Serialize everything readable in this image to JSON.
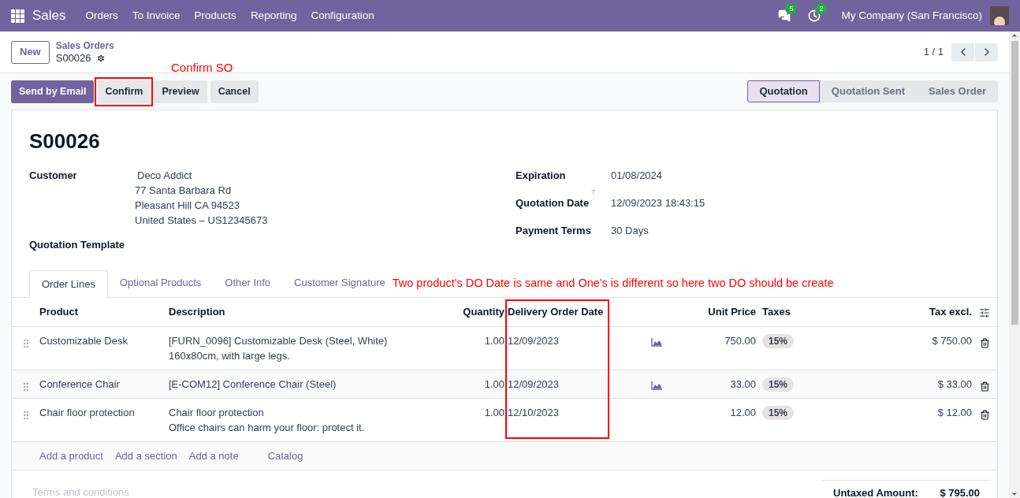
{
  "navbar": {
    "app": "Sales",
    "menu": [
      "Orders",
      "To Invoice",
      "Products",
      "Reporting",
      "Configuration"
    ],
    "messages_count": "5",
    "activities_count": "2",
    "company": "My Company (San Francisco)"
  },
  "control_panel": {
    "new_button": "New",
    "breadcrumb_parent": "Sales Orders",
    "record": "S00026",
    "pager": "1 / 1"
  },
  "actions": [
    {
      "label": "Send by Email",
      "kind": "primary",
      "highlighted": false
    },
    {
      "label": "Confirm",
      "kind": "secondary",
      "highlighted": true
    },
    {
      "label": "Preview",
      "kind": "secondary",
      "highlighted": false
    },
    {
      "label": "Cancel",
      "kind": "secondary",
      "highlighted": false
    }
  ],
  "confirm_note": "Confirm SO",
  "status_steps": [
    {
      "label": "Quotation",
      "selected": true
    },
    {
      "label": "Quotation Sent",
      "selected": false
    },
    {
      "label": "Sales Order",
      "selected": false
    }
  ],
  "form": {
    "title": "S00026",
    "customer": {
      "label": "Customer",
      "name": "Deco Addict",
      "address": [
        "77 Santa Barbara Rd",
        "Pleasant Hill CA 94523",
        "United States – US12345673"
      ]
    },
    "quotation_template": {
      "label": "Quotation Template"
    },
    "right_fields": [
      {
        "label": "Expiration",
        "value": "01/08/2024",
        "help": false
      },
      {
        "label": "Quotation Date",
        "value": "12/09/2023 18:43:15",
        "help": true
      },
      {
        "label": "Payment Terms",
        "value": "30 Days",
        "help": false
      }
    ]
  },
  "help_mark": "?",
  "tabs": [
    {
      "label": "Order Lines",
      "selected": true
    },
    {
      "label": "Optional Products",
      "selected": false
    },
    {
      "label": "Other Info",
      "selected": false
    },
    {
      "label": "Customer Signature",
      "selected": false
    }
  ],
  "tabs_note": "Two product's DO Date is same and One's is different so here two DO should be create",
  "table": {
    "columns": [
      "Product",
      "Description",
      "Quantity",
      "Delivery Order Date",
      "Unit Price",
      "Taxes",
      "Tax excl."
    ],
    "rows": [
      {
        "product": "Customizable Desk",
        "description": [
          "[FURN_0096] Customizable Desk (Steel, White)",
          "160x80cm, with large legs."
        ],
        "quantity": "1.00",
        "delivery_date": "12/09/2023",
        "forecast_icon": true,
        "unit_price": "750.00",
        "taxes": "15%",
        "subtotal": "$ 750.00"
      },
      {
        "product": "Conference Chair",
        "description": [
          "[E-COM12] Conference Chair (Steel)"
        ],
        "quantity": "1.00",
        "delivery_date": "12/09/2023",
        "forecast_icon": true,
        "unit_price": "33.00",
        "taxes": "15%",
        "subtotal": "$ 33.00"
      },
      {
        "product": "Chair floor protection",
        "description": [
          "Chair floor protection",
          "Office chairs can harm your floor: protect it."
        ],
        "quantity": "1.00",
        "delivery_date": "12/10/2023",
        "forecast_icon": false,
        "unit_price": "12.00",
        "taxes": "15%",
        "subtotal": "$ 12.00"
      }
    ],
    "add_links": [
      "Add a product",
      "Add a section",
      "Add a note",
      "Catalog"
    ]
  },
  "footer": {
    "terms_placeholder": "Terms and conditions",
    "untaxed_label": "Untaxed Amount:",
    "untaxed_value": "$ 795.00"
  }
}
